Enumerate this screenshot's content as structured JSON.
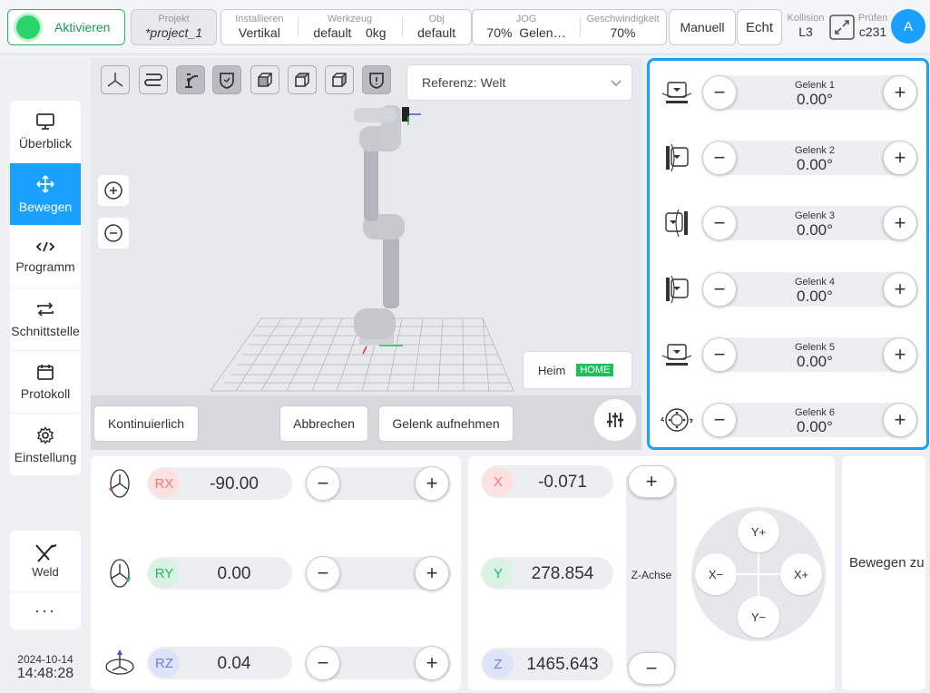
{
  "topbar": {
    "activate_label": "Aktivieren",
    "project": {
      "label": "Projekt",
      "value": "*project_1"
    },
    "installieren": {
      "label": "Installieren",
      "value": "Vertikal"
    },
    "werkzeug": {
      "label": "Werkzeug",
      "value": "default    0kg"
    },
    "obj": {
      "label": "Obj",
      "value": "default"
    },
    "jog": {
      "label": "JOG",
      "value": "70%  Gelen…"
    },
    "speed": {
      "label": "Geschwindigkeit",
      "value": "70%"
    },
    "mode_label": "Manuell",
    "real_label": "Echt",
    "kollision": {
      "label": "Kollision",
      "value": "L3"
    },
    "pruefen": {
      "label": "Prüfen",
      "value": "c231"
    },
    "avatar_letter": "A"
  },
  "nav": {
    "items": [
      {
        "label": "Überblick",
        "icon": "monitor-icon"
      },
      {
        "label": "Bewegen",
        "icon": "move-icon"
      },
      {
        "label": "Programm",
        "icon": "code-icon"
      },
      {
        "label": "Schnittstelle",
        "icon": "swap-icon"
      },
      {
        "label": "Protokoll",
        "icon": "calendar-icon"
      },
      {
        "label": "Einstellung",
        "icon": "gear-icon"
      }
    ],
    "weld_label": "Weld",
    "more_label": "···"
  },
  "clock": {
    "date": "2024-10-14",
    "time": "14:48:28"
  },
  "view": {
    "reference_label": "Referenz: Welt",
    "home_label": "Heim",
    "home_badge": "HOME",
    "continuous_label": "Kontinuierlich",
    "cancel_label": "Abbrechen",
    "record_label": "Gelenk aufnehmen"
  },
  "joints": [
    {
      "name": "Gelenk 1",
      "value": "0.00°"
    },
    {
      "name": "Gelenk 2",
      "value": "0.00°"
    },
    {
      "name": "Gelenk 3",
      "value": "0.00°"
    },
    {
      "name": "Gelenk 4",
      "value": "0.00°"
    },
    {
      "name": "Gelenk 5",
      "value": "0.00°"
    },
    {
      "name": "Gelenk 6",
      "value": "0.00°"
    }
  ],
  "rotation": [
    {
      "tag": "RX",
      "value": "-90.00",
      "color": "#f07a7a",
      "bg": "#fde0e0"
    },
    {
      "tag": "RY",
      "value": "0.00",
      "color": "#2bb36b",
      "bg": "#d8f3e2"
    },
    {
      "tag": "RZ",
      "value": "0.04",
      "color": "#6b7fd8",
      "bg": "#dfe3f7"
    }
  ],
  "translation": [
    {
      "tag": "X",
      "value": "-0.071",
      "color": "#f07a7a",
      "bg": "#fde0e0"
    },
    {
      "tag": "Y",
      "value": "278.854",
      "color": "#2bb36b",
      "bg": "#d8f3e2"
    },
    {
      "tag": "Z",
      "value": "1465.643",
      "color": "#6b7fd8",
      "bg": "#dfe3f7"
    }
  ],
  "zaxis_label": "Z-Achse",
  "dpad": {
    "up": "Y+",
    "down": "Y−",
    "left": "X−",
    "right": "X+"
  },
  "move_to_label": "Bewegen zu",
  "colors": {
    "accent": "#1aa1ff",
    "active_green": "#2bd36b"
  }
}
